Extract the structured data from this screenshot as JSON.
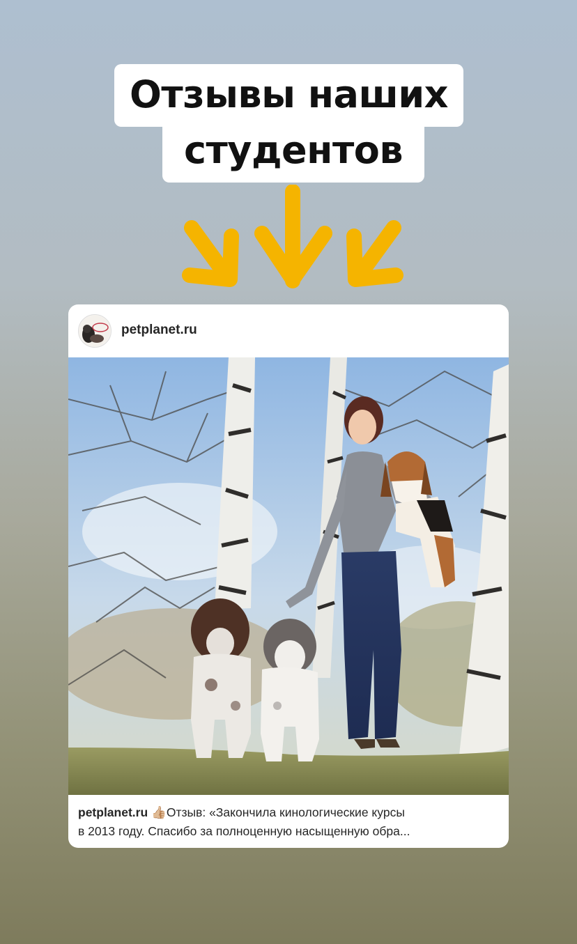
{
  "title": {
    "line1": "Отзывы наших",
    "line2": "студентов"
  },
  "colors": {
    "arrow": "#f5b400"
  },
  "post": {
    "username": "petplanet.ru",
    "caption_user": "petplanet.ru",
    "caption_emoji": "👍🏼",
    "caption_line1": "Отзыв: «Закончила кинологические курсы",
    "caption_line2": "в 2013 году. Спасибо за полноценную насыщенную обра..."
  }
}
